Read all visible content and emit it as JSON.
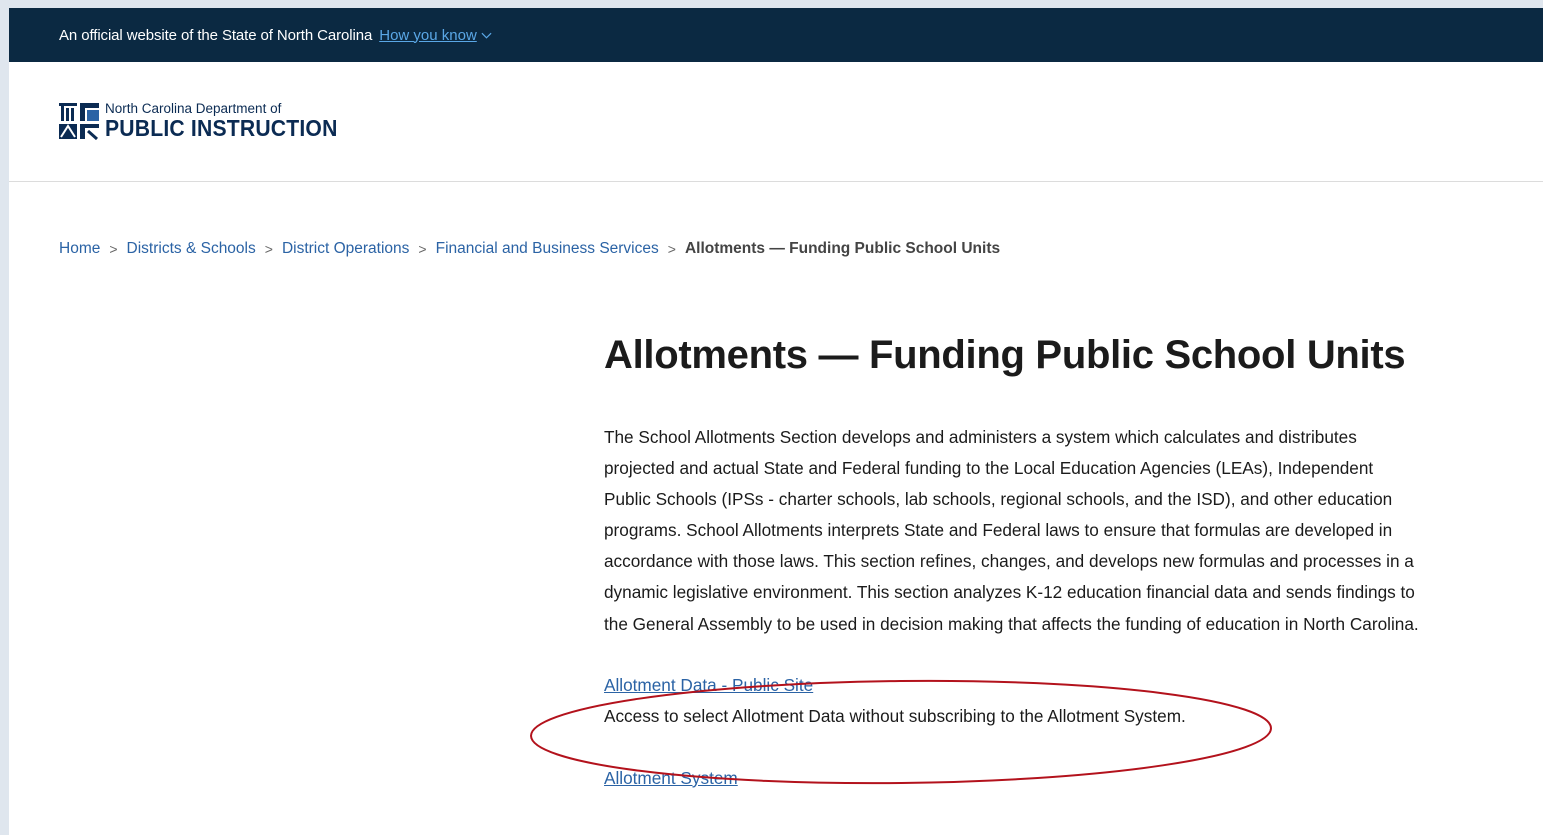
{
  "gov_banner": {
    "official_text": "An official website of the State of North Carolina",
    "how_you_know": "How you know"
  },
  "logo": {
    "line1": "North Carolina Department of",
    "line2": "PUBLIC INSTRUCTION"
  },
  "breadcrumb": {
    "items": [
      "Home",
      "Districts & Schools",
      "District Operations",
      "Financial and Business Services"
    ],
    "current": "Allotments — Funding Public School Units",
    "separator": ">"
  },
  "main": {
    "title": "Allotments — Funding Public School Units",
    "intro": "The School Allotments Section develops and administers a system which calculates and distributes projected and actual State and Federal funding to the Local Education Agencies (LEAs), Independent Public Schools (IPSs - charter schools, lab schools, regional schools, and the ISD), and other education programs. School Allotments interprets State and Federal laws to ensure that formulas are developed in accordance with those laws. This section refines, changes, and develops new formulas and processes in a dynamic legislative environment. This section analyzes K-12 education financial data and sends findings to the General Assembly to be used in decision making that affects the funding of education in North Carolina.",
    "links": [
      {
        "label": "Allotment Data - Public Site",
        "description": "Access to select Allotment Data without subscribing to the Allotment System."
      },
      {
        "label": "Allotment System"
      }
    ]
  },
  "colors": {
    "banner_bg": "#0b2942",
    "link": "#2b63a5",
    "logo_navy": "#0b2b53",
    "annotation_red": "#b3121c"
  },
  "icons": {
    "banner_chevron": "chevron-down-icon",
    "logo_mark": "ncdpi-logo-icon",
    "annotation": "red-ellipse-annotation"
  }
}
